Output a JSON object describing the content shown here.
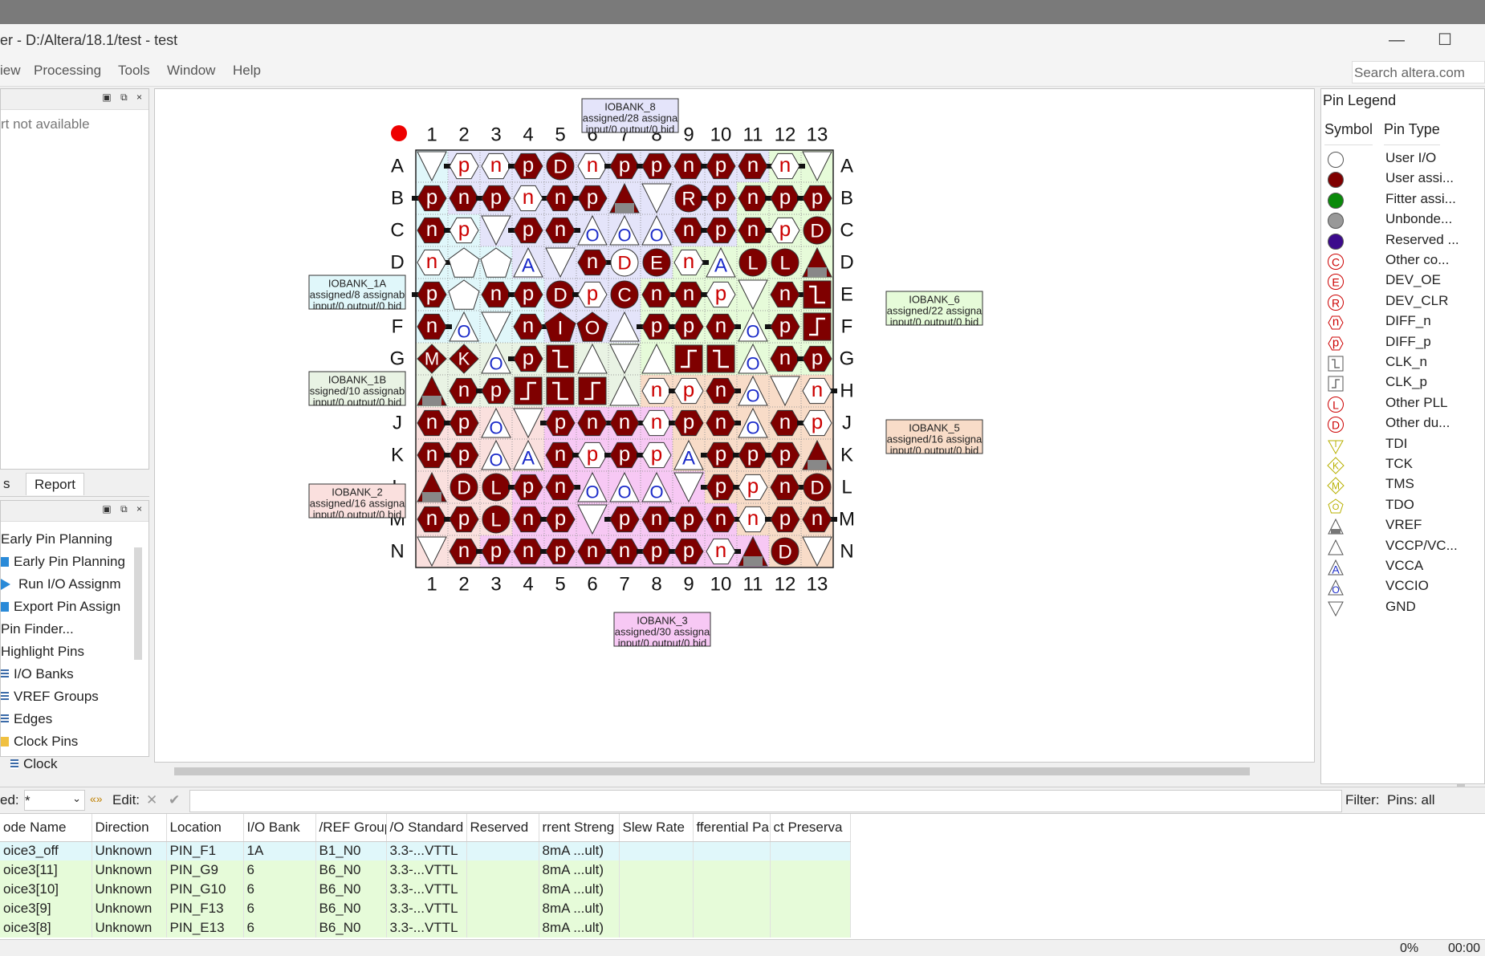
{
  "window": {
    "title": "er - D:/Altera/18.1/test - test",
    "minimize_glyph": "—",
    "maximize_glyph": "☐"
  },
  "menu": [
    "iew",
    "Processing",
    "Tools",
    "Window",
    "Help"
  ],
  "search": {
    "placeholder": "Search altera.com"
  },
  "left_top": {
    "message": "rt not available",
    "buttons": "▣ ⧉ ×"
  },
  "left_tabs": [
    "s",
    "Report"
  ],
  "left_bottom": {
    "buttons": "▣ ⧉ ×",
    "tree": [
      {
        "label": "Early Pin Planning",
        "icon": "none",
        "level": 0
      },
      {
        "label": "Early Pin Planning",
        "icon": "blue-square-icon",
        "level": 1
      },
      {
        "label": "Run I/O Assignm",
        "icon": "run-arrow-icon",
        "level": 1
      },
      {
        "label": "Export Pin Assign",
        "icon": "blue-square-icon",
        "level": 1
      },
      {
        "label": "Pin Finder...",
        "icon": "none",
        "level": 0
      },
      {
        "label": "Highlight Pins",
        "icon": "none",
        "level": 0
      },
      {
        "label": "I/O Banks",
        "icon": "table-icon",
        "level": 1
      },
      {
        "label": "VREF Groups",
        "icon": "table-icon",
        "level": 1
      },
      {
        "label": "Edges",
        "icon": "table-icon",
        "level": 1
      },
      {
        "label": "Clock Pins",
        "icon": "folder-icon",
        "level": 1
      },
      {
        "label": "Clock",
        "icon": "table-icon",
        "level": 2
      }
    ]
  },
  "chip": {
    "cols": [
      "1",
      "2",
      "3",
      "4",
      "5",
      "6",
      "7",
      "8",
      "9",
      "10",
      "11",
      "12",
      "13"
    ],
    "rows": [
      "A",
      "B",
      "C",
      "D",
      "E",
      "F",
      "G",
      "H",
      "J",
      "K",
      "L",
      "M",
      "N"
    ],
    "grid": [
      "gv pn nw pf Df nw pf pf nf pf nf nw gv",
      "pf nf pf nw nf pf vr gv Rf pf nf pf pf",
      "nf pw gv pf nf oi oi oi nf pf nf pw Df",
      "nw Ow Ow ai gv nf Dw Ef nw ai Lf Lf vr",
      "pf Ow nf pf Df pw Cf nf nf pw gv nf kf",
      "nf oi gv nf If Of vc pf pf nf oi pf kp",
      "Mf Kf oi pf kf vc gv vc kp kf oi nf pf",
      "vr nf pf kp kf kp vc nw pw nf oi gv nw",
      "nf pf oi gv pf nf nf nw pf nf oi nf pw",
      "nf pf oi ai nf pw pf pw ai pf pf pf vr",
      "vr Df Lf pf nf oi oi oi gv pf pw nf Df",
      "nf pf Lf nf pf gv pf nf pf nf nw pf nf",
      "gv nf pf nf pf nf nf pf pf nw vr Df gv"
    ],
    "bank_layout": [
      "1A 8 8 8 8 8 8 8 8 8 8 6 6",
      "1A 8 8 8 8 8 8 8 8 8 6 6 6",
      "1A 1A 8 8 8 8 8 8 8 8 6 6 6",
      "1A 1A 1A 8 8 8 8 8 6 6 6 6 6",
      "1A 1A 1A 1A 8 8 8 6 6 6 6 6 6",
      "1A 1A 1A 1A 8 8 8 6 6 6 6 6 6",
      "1B 1B 1B 1B 1B 1B 1B 6 6 6 6 6 6",
      "1B 1B 1B 1B 1B 1B 1B 5 5 5 5 5 5",
      "2 2 2 2 3 3 3 3 5 5 5 5 5",
      "2 2 2 2 3 3 3 3 5 5 5 5 5",
      "2 2 2 3 3 3 3 3 3 5 5 5 5",
      "2 2 2 3 3 3 3 3 3 3 5 5 5",
      "2 2 3 3 3 3 3 3 3 3 3 5 5"
    ],
    "bank_colors": {
      "1A": "#e0f7fa",
      "1B": "#e9f3e4",
      "8": "#e4e4fa",
      "6": "#e6fbd9",
      "5": "#f8dcc8",
      "3": "#f7c8f4",
      "2": "#fae0de"
    },
    "banks": [
      {
        "id": "8",
        "name": "IOBANK_8",
        "line1": "assigned/28 assigna",
        "line2": "input/0 output/0 bid",
        "side": "top"
      },
      {
        "id": "1A",
        "name": "IOBANK_1A",
        "line1": "assigned/8 assignab",
        "line2": "input/0 output/0 bid",
        "side": "left"
      },
      {
        "id": "1B",
        "name": "IOBANK_1B",
        "line1": "ssigned/10 assignab",
        "line2": "input/0 output/0 bid",
        "side": "left"
      },
      {
        "id": "2",
        "name": "IOBANK_2",
        "line1": "assigned/16 assigna",
        "line2": "input/0 output/0 bid",
        "side": "left"
      },
      {
        "id": "6",
        "name": "IOBANK_6",
        "line1": "assigned/22 assigna",
        "line2": "input/0 output/0 bid",
        "side": "right"
      },
      {
        "id": "5",
        "name": "IOBANK_5",
        "line1": "assigned/16 assigna",
        "line2": "input/0 output/0 bid",
        "side": "right"
      },
      {
        "id": "3",
        "name": "IOBANK_3",
        "line1": "assigned/30 assigna",
        "line2": "input/0 output/0 bid",
        "side": "bottom"
      }
    ],
    "colors": {
      "dark": "#7f0000",
      "text_red": "#cc0000",
      "blue": "#1b2bc9",
      "pin1": "#ee0000"
    }
  },
  "legend": {
    "title": "Pin Legend",
    "headers": [
      "Symbol",
      "Pin Type"
    ],
    "items": [
      {
        "sym": "circle-white",
        "label": "User I/O"
      },
      {
        "sym": "circle-darkred",
        "label": "User assi..."
      },
      {
        "sym": "circle-green",
        "label": "Fitter assi..."
      },
      {
        "sym": "circle-gray",
        "label": "Unbonde..."
      },
      {
        "sym": "circle-purple",
        "label": "Reserved ..."
      },
      {
        "sym": "letter-C",
        "label": "Other co..."
      },
      {
        "sym": "letter-E",
        "label": "DEV_OE"
      },
      {
        "sym": "letter-R",
        "label": "DEV_CLR"
      },
      {
        "sym": "hex-n",
        "label": "DIFF_n"
      },
      {
        "sym": "hex-p",
        "label": "DIFF_p"
      },
      {
        "sym": "clk-n",
        "label": "CLK_n"
      },
      {
        "sym": "clk-p",
        "label": "CLK_p"
      },
      {
        "sym": "letter-L",
        "label": "Other PLL"
      },
      {
        "sym": "letter-D",
        "label": "Other du..."
      },
      {
        "sym": "tdi",
        "label": "TDI"
      },
      {
        "sym": "tck",
        "label": "TCK"
      },
      {
        "sym": "tms",
        "label": "TMS"
      },
      {
        "sym": "tdo",
        "label": "TDO"
      },
      {
        "sym": "vref",
        "label": "VREF"
      },
      {
        "sym": "vccp",
        "label": "VCCP/VC..."
      },
      {
        "sym": "vcca",
        "label": "VCCA"
      },
      {
        "sym": "vccio",
        "label": "VCCIO"
      },
      {
        "sym": "gnd",
        "label": "GND"
      }
    ]
  },
  "filter_bar": {
    "named_label": "ed:",
    "named_value": "*",
    "edit_label": "Edit:",
    "filter_label": "Filter:",
    "filter_value": "Pins: all"
  },
  "table": {
    "columns": [
      "ode Name",
      "Direction",
      "Location",
      "I/O Bank",
      "/REF Group",
      "/O Standard",
      "Reserved",
      "rrent Streng",
      "Slew Rate",
      "fferential Pa",
      "ct Preserva"
    ],
    "rows": [
      [
        "oice3_off",
        "Unknown",
        "PIN_F1",
        "1A",
        "B1_N0",
        "3.3-...VTTL",
        "",
        "8mA ...ult)",
        "",
        "",
        ""
      ],
      [
        "oice3[11]",
        "Unknown",
        "PIN_G9",
        "6",
        "B6_N0",
        "3.3-...VTTL",
        "",
        "8mA ...ult)",
        "",
        "",
        ""
      ],
      [
        "oice3[10]",
        "Unknown",
        "PIN_G10",
        "6",
        "B6_N0",
        "3.3-...VTTL",
        "",
        "8mA ...ult)",
        "",
        "",
        ""
      ],
      [
        "oice3[9]",
        "Unknown",
        "PIN_F13",
        "6",
        "B6_N0",
        "3.3-...VTTL",
        "",
        "8mA ...ult)",
        "",
        "",
        ""
      ],
      [
        "oice3[8]",
        "Unknown",
        "PIN_E13",
        "6",
        "B6_N0",
        "3.3-...VTTL",
        "",
        "8mA ...ult)",
        "",
        "",
        ""
      ]
    ],
    "row_colors": [
      "#e0f7fa",
      "#e6fbd9",
      "#e6fbd9",
      "#e6fbd9",
      "#e6fbd9"
    ]
  },
  "status": {
    "progress": "0%",
    "time": "00:00"
  }
}
